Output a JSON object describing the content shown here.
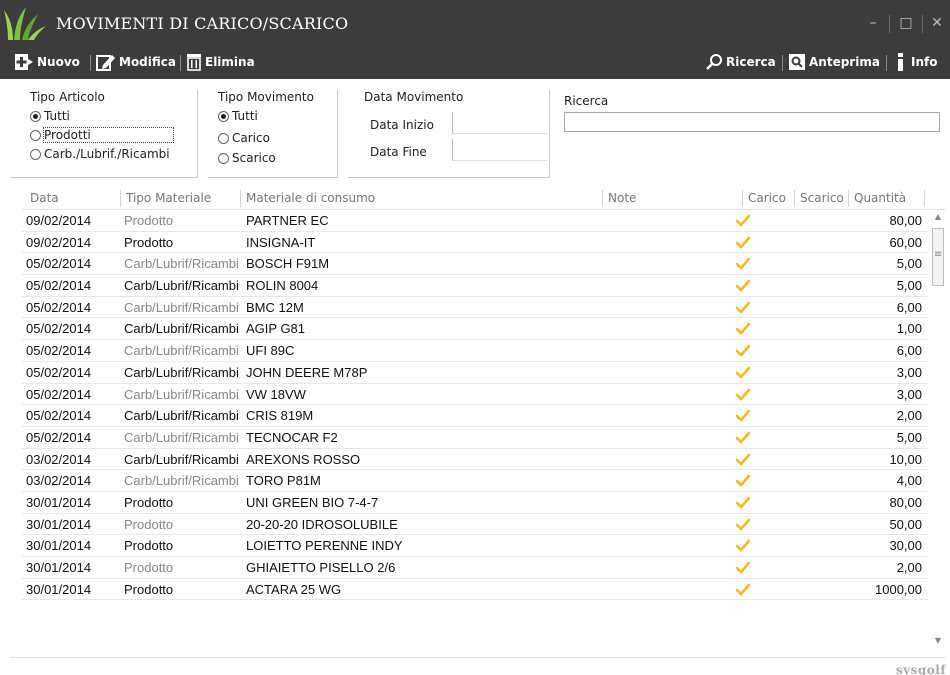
{
  "window": {
    "title": "MOVIMENTI DI CARICO/SCARICO",
    "minimize_symbol": "–",
    "maximize_symbol": "□",
    "close_symbol": "✕"
  },
  "toolbar": {
    "nuovo": "Nuovo",
    "modifica": "Modifica",
    "elimina": "Elimina",
    "ricerca": "Ricerca",
    "anteprima": "Anteprima",
    "info": "Info"
  },
  "filters": {
    "tipo_articolo": {
      "title": "Tipo Articolo",
      "options": [
        "Tutti",
        "Prodotti",
        "Carb./Lubrif./Ricambi"
      ],
      "selected": "Tutti"
    },
    "tipo_movimento": {
      "title": "Tipo Movimento",
      "options": [
        "Tutti",
        "Carico",
        "Scarico"
      ],
      "selected": "Tutti"
    },
    "data_movimento": {
      "title": "Data Movimento",
      "inizio_label": "Data Inizio",
      "fine_label": "Data Fine",
      "inizio_value": "",
      "fine_value": ""
    },
    "ricerca": {
      "label": "Ricerca",
      "value": ""
    }
  },
  "table": {
    "columns": [
      "Data",
      "Tipo Materiale",
      "Materiale di consumo",
      "Note",
      "Carico",
      "Scarico",
      "Quantità"
    ],
    "rows": [
      {
        "data": "09/02/2014",
        "tipo": "Prodotto",
        "materiale": "PARTNER EC",
        "carico": true,
        "qty": "80,00",
        "tone": "light"
      },
      {
        "data": "09/02/2014",
        "tipo": "Prodotto",
        "materiale": "INSIGNA-IT",
        "carico": true,
        "qty": "60,00",
        "tone": "dark"
      },
      {
        "data": "05/02/2014",
        "tipo": "Carb/Lubrif/Ricambi",
        "materiale": "BOSCH F91M",
        "carico": true,
        "qty": "5,00",
        "tone": "light"
      },
      {
        "data": "05/02/2014",
        "tipo": "Carb/Lubrif/Ricambi",
        "materiale": "ROLIN 8004",
        "carico": true,
        "qty": "5,00",
        "tone": "dark"
      },
      {
        "data": "05/02/2014",
        "tipo": "Carb/Lubrif/Ricambi",
        "materiale": "BMC 12M",
        "carico": true,
        "qty": "6,00",
        "tone": "light"
      },
      {
        "data": "05/02/2014",
        "tipo": "Carb/Lubrif/Ricambi",
        "materiale": "AGIP G81",
        "carico": true,
        "qty": "1,00",
        "tone": "dark"
      },
      {
        "data": "05/02/2014",
        "tipo": "Carb/Lubrif/Ricambi",
        "materiale": "UFI 89C",
        "carico": true,
        "qty": "6,00",
        "tone": "light"
      },
      {
        "data": "05/02/2014",
        "tipo": "Carb/Lubrif/Ricambi",
        "materiale": "JOHN DEERE M78P",
        "carico": true,
        "qty": "3,00",
        "tone": "dark"
      },
      {
        "data": "05/02/2014",
        "tipo": "Carb/Lubrif/Ricambi",
        "materiale": "VW 18VW",
        "carico": true,
        "qty": "3,00",
        "tone": "light"
      },
      {
        "data": "05/02/2014",
        "tipo": "Carb/Lubrif/Ricambi",
        "materiale": "CRIS 819M",
        "carico": true,
        "qty": "2,00",
        "tone": "dark"
      },
      {
        "data": "05/02/2014",
        "tipo": "Carb/Lubrif/Ricambi",
        "materiale": "TECNOCAR F2",
        "carico": true,
        "qty": "5,00",
        "tone": "light"
      },
      {
        "data": "03/02/2014",
        "tipo": "Carb/Lubrif/Ricambi",
        "materiale": "AREXONS ROSSO",
        "carico": true,
        "qty": "10,00",
        "tone": "dark"
      },
      {
        "data": "03/02/2014",
        "tipo": "Carb/Lubrif/Ricambi",
        "materiale": "TORO P81M",
        "carico": true,
        "qty": "4,00",
        "tone": "light"
      },
      {
        "data": "30/01/2014",
        "tipo": "Prodotto",
        "materiale": "UNI GREEN BIO 7-4-7",
        "carico": true,
        "qty": "80,00",
        "tone": "dark"
      },
      {
        "data": "30/01/2014",
        "tipo": "Prodotto",
        "materiale": "20-20-20 IDROSOLUBILE",
        "carico": true,
        "qty": "50,00",
        "tone": "light"
      },
      {
        "data": "30/01/2014",
        "tipo": "Prodotto",
        "materiale": "LOIETTO PERENNE INDY",
        "carico": true,
        "qty": "30,00",
        "tone": "dark"
      },
      {
        "data": "30/01/2014",
        "tipo": "Prodotto",
        "materiale": "GHIAIETTO  PISELLO 2/6",
        "carico": true,
        "qty": "2,00",
        "tone": "light"
      },
      {
        "data": "30/01/2014",
        "tipo": "Prodotto",
        "materiale": "ACTARA 25 WG",
        "carico": true,
        "qty": "1000,00",
        "tone": "dark"
      }
    ]
  },
  "footer": {
    "brand": "sysgolf"
  },
  "colors": {
    "titlebar_bg": "#3c3c3c",
    "check": "#f5b820",
    "logo_green": "#7cc242"
  }
}
